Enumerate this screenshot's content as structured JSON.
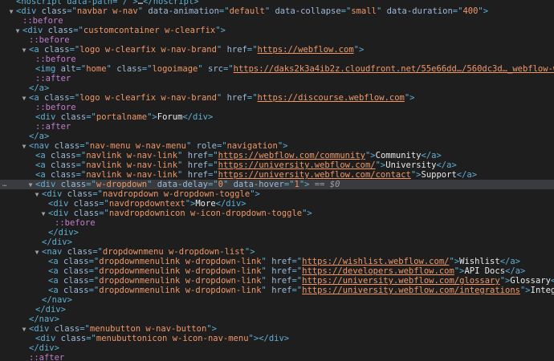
{
  "lines": [
    {
      "indent": 0,
      "arrow": "",
      "parts": [
        {
          "t": "tag",
          "v": "<noscript data-path=\"/\">"
        },
        {
          "t": "text",
          "v": "…"
        },
        {
          "t": "tag",
          "v": "</noscript>"
        }
      ]
    },
    {
      "indent": 0,
      "arrow": "▼",
      "parts": [
        {
          "t": "tag",
          "v": "<div "
        },
        {
          "t": "attr",
          "v": "class"
        },
        {
          "t": "tag",
          "v": "=\""
        },
        {
          "t": "val",
          "v": "navbar w-nav"
        },
        {
          "t": "tag",
          "v": "\" "
        },
        {
          "t": "attr",
          "v": "data-animation"
        },
        {
          "t": "tag",
          "v": "=\""
        },
        {
          "t": "val",
          "v": "default"
        },
        {
          "t": "tag",
          "v": "\" "
        },
        {
          "t": "attr",
          "v": "data-collapse"
        },
        {
          "t": "tag",
          "v": "=\""
        },
        {
          "t": "val",
          "v": "small"
        },
        {
          "t": "tag",
          "v": "\" "
        },
        {
          "t": "attr",
          "v": "data-duration"
        },
        {
          "t": "tag",
          "v": "=\""
        },
        {
          "t": "val",
          "v": "400"
        },
        {
          "t": "tag",
          "v": "\">"
        }
      ]
    },
    {
      "indent": 1,
      "arrow": "",
      "parts": [
        {
          "t": "pseudo",
          "v": "::before"
        }
      ]
    },
    {
      "indent": 1,
      "arrow": "▼",
      "parts": [
        {
          "t": "tag",
          "v": "<div "
        },
        {
          "t": "attr",
          "v": "class"
        },
        {
          "t": "tag",
          "v": "=\""
        },
        {
          "t": "val",
          "v": "customcontainer w-clearfix"
        },
        {
          "t": "tag",
          "v": "\">"
        }
      ]
    },
    {
      "indent": 2,
      "arrow": "",
      "parts": [
        {
          "t": "pseudo",
          "v": "::before"
        }
      ]
    },
    {
      "indent": 2,
      "arrow": "▼",
      "parts": [
        {
          "t": "tag",
          "v": "<a "
        },
        {
          "t": "attr",
          "v": "class"
        },
        {
          "t": "tag",
          "v": "=\""
        },
        {
          "t": "val",
          "v": "logo w-clearfix w-nav-brand"
        },
        {
          "t": "tag",
          "v": "\" "
        },
        {
          "t": "attr",
          "v": "href"
        },
        {
          "t": "tag",
          "v": "=\""
        },
        {
          "t": "link",
          "v": "https://webflow.com"
        },
        {
          "t": "tag",
          "v": "\">"
        }
      ]
    },
    {
      "indent": 3,
      "arrow": "",
      "parts": [
        {
          "t": "pseudo",
          "v": "::before"
        }
      ]
    },
    {
      "indent": 3,
      "arrow": "",
      "parts": [
        {
          "t": "tag",
          "v": "<img "
        },
        {
          "t": "attr",
          "v": "alt"
        },
        {
          "t": "tag",
          "v": "=\""
        },
        {
          "t": "val",
          "v": "home"
        },
        {
          "t": "tag",
          "v": "\" "
        },
        {
          "t": "attr",
          "v": "class"
        },
        {
          "t": "tag",
          "v": "=\""
        },
        {
          "t": "val",
          "v": "logoimage"
        },
        {
          "t": "tag",
          "v": "\" "
        },
        {
          "t": "attr",
          "v": "src"
        },
        {
          "t": "tag",
          "v": "=\""
        },
        {
          "t": "link",
          "v": "https://daks2k3a4ib2z.cloudfront.net/55e66dd…/560dc3d…_webflow-white.svg"
        },
        {
          "t": "tag",
          "v": "\" "
        },
        {
          "t": "attr",
          "v": "width"
        },
        {
          "t": "tag",
          "v": "=\""
        },
        {
          "t": "val",
          "v": "87"
        },
        {
          "t": "tag",
          "v": "\">"
        }
      ]
    },
    {
      "indent": 3,
      "arrow": "",
      "parts": [
        {
          "t": "pseudo",
          "v": "::after"
        }
      ]
    },
    {
      "indent": 2,
      "arrow": "",
      "parts": [
        {
          "t": "tag",
          "v": "</a>"
        }
      ]
    },
    {
      "indent": 2,
      "arrow": "▼",
      "parts": [
        {
          "t": "tag",
          "v": "<a "
        },
        {
          "t": "attr",
          "v": "class"
        },
        {
          "t": "tag",
          "v": "=\""
        },
        {
          "t": "val",
          "v": "logo w-clearfix w-nav-brand"
        },
        {
          "t": "tag",
          "v": "\" "
        },
        {
          "t": "attr",
          "v": "href"
        },
        {
          "t": "tag",
          "v": "=\""
        },
        {
          "t": "link",
          "v": "https://discourse.webflow.com"
        },
        {
          "t": "tag",
          "v": "\">"
        }
      ]
    },
    {
      "indent": 3,
      "arrow": "",
      "parts": [
        {
          "t": "pseudo",
          "v": "::before"
        }
      ]
    },
    {
      "indent": 3,
      "arrow": "",
      "parts": [
        {
          "t": "tag",
          "v": "<div "
        },
        {
          "t": "attr",
          "v": "class"
        },
        {
          "t": "tag",
          "v": "=\""
        },
        {
          "t": "val",
          "v": "portalname"
        },
        {
          "t": "tag",
          "v": "\">"
        },
        {
          "t": "text",
          "v": "Forum"
        },
        {
          "t": "tag",
          "v": "</div>"
        }
      ]
    },
    {
      "indent": 3,
      "arrow": "",
      "parts": [
        {
          "t": "pseudo",
          "v": "::after"
        }
      ]
    },
    {
      "indent": 2,
      "arrow": "",
      "parts": [
        {
          "t": "tag",
          "v": "</a>"
        }
      ]
    },
    {
      "indent": 2,
      "arrow": "▼",
      "parts": [
        {
          "t": "tag",
          "v": "<nav "
        },
        {
          "t": "attr",
          "v": "class"
        },
        {
          "t": "tag",
          "v": "=\""
        },
        {
          "t": "val",
          "v": "nav-menu w-nav-menu"
        },
        {
          "t": "tag",
          "v": "\" "
        },
        {
          "t": "attr",
          "v": "role"
        },
        {
          "t": "tag",
          "v": "=\""
        },
        {
          "t": "val",
          "v": "navigation"
        },
        {
          "t": "tag",
          "v": "\">"
        }
      ]
    },
    {
      "indent": 3,
      "arrow": "",
      "parts": [
        {
          "t": "tag",
          "v": "<a "
        },
        {
          "t": "attr",
          "v": "class"
        },
        {
          "t": "tag",
          "v": "=\""
        },
        {
          "t": "val",
          "v": "navlink w-nav-link"
        },
        {
          "t": "tag",
          "v": "\" "
        },
        {
          "t": "attr",
          "v": "href"
        },
        {
          "t": "tag",
          "v": "=\""
        },
        {
          "t": "link",
          "v": "https://webflow.com/community"
        },
        {
          "t": "tag",
          "v": "\">"
        },
        {
          "t": "text",
          "v": "Community"
        },
        {
          "t": "tag",
          "v": "</a>"
        }
      ]
    },
    {
      "indent": 3,
      "arrow": "",
      "parts": [
        {
          "t": "tag",
          "v": "<a "
        },
        {
          "t": "attr",
          "v": "class"
        },
        {
          "t": "tag",
          "v": "=\""
        },
        {
          "t": "val",
          "v": "navlink w-nav-link"
        },
        {
          "t": "tag",
          "v": "\" "
        },
        {
          "t": "attr",
          "v": "href"
        },
        {
          "t": "tag",
          "v": "=\""
        },
        {
          "t": "link",
          "v": "https://university.webflow.com/"
        },
        {
          "t": "tag",
          "v": "\">"
        },
        {
          "t": "text",
          "v": "University"
        },
        {
          "t": "tag",
          "v": "</a>"
        }
      ]
    },
    {
      "indent": 3,
      "arrow": "",
      "parts": [
        {
          "t": "tag",
          "v": "<a "
        },
        {
          "t": "attr",
          "v": "class"
        },
        {
          "t": "tag",
          "v": "=\""
        },
        {
          "t": "val",
          "v": "navlink w-nav-link"
        },
        {
          "t": "tag",
          "v": "\" "
        },
        {
          "t": "attr",
          "v": "href"
        },
        {
          "t": "tag",
          "v": "=\""
        },
        {
          "t": "link",
          "v": "https://university.webflow.com/contact"
        },
        {
          "t": "tag",
          "v": "\">"
        },
        {
          "t": "text",
          "v": "Support"
        },
        {
          "t": "tag",
          "v": "</a>"
        }
      ]
    },
    {
      "indent": 3,
      "arrow": "▼",
      "selected": true,
      "gutter": "…",
      "parts": [
        {
          "t": "tag",
          "v": "<div "
        },
        {
          "t": "attr",
          "v": "class"
        },
        {
          "t": "tag",
          "v": "=\""
        },
        {
          "t": "val",
          "v": "w-dropdown"
        },
        {
          "t": "tag",
          "v": "\" "
        },
        {
          "t": "attr",
          "v": "data-delay"
        },
        {
          "t": "tag",
          "v": "=\""
        },
        {
          "t": "val",
          "v": "0"
        },
        {
          "t": "tag",
          "v": "\" "
        },
        {
          "t": "attr",
          "v": "data-hover"
        },
        {
          "t": "tag",
          "v": "=\""
        },
        {
          "t": "val",
          "v": "1"
        },
        {
          "t": "tag",
          "v": "\">"
        },
        {
          "t": "eq",
          "v": " == "
        },
        {
          "t": "dollar",
          "v": "$0"
        }
      ]
    },
    {
      "indent": 4,
      "arrow": "▼",
      "parts": [
        {
          "t": "tag",
          "v": "<div "
        },
        {
          "t": "attr",
          "v": "class"
        },
        {
          "t": "tag",
          "v": "=\""
        },
        {
          "t": "val",
          "v": "navdropdown w-dropdown-toggle"
        },
        {
          "t": "tag",
          "v": "\">"
        }
      ]
    },
    {
      "indent": 5,
      "arrow": "",
      "parts": [
        {
          "t": "tag",
          "v": "<div "
        },
        {
          "t": "attr",
          "v": "class"
        },
        {
          "t": "tag",
          "v": "=\""
        },
        {
          "t": "val",
          "v": "navdropdowntext"
        },
        {
          "t": "tag",
          "v": "\">"
        },
        {
          "t": "text",
          "v": "More"
        },
        {
          "t": "tag",
          "v": "</div>"
        }
      ]
    },
    {
      "indent": 5,
      "arrow": "▼",
      "parts": [
        {
          "t": "tag",
          "v": "<div "
        },
        {
          "t": "attr",
          "v": "class"
        },
        {
          "t": "tag",
          "v": "=\""
        },
        {
          "t": "val",
          "v": "navdropdownicon w-icon-dropdown-toggle"
        },
        {
          "t": "tag",
          "v": "\">"
        }
      ]
    },
    {
      "indent": 6,
      "arrow": "",
      "parts": [
        {
          "t": "pseudo",
          "v": "::before"
        }
      ]
    },
    {
      "indent": 5,
      "arrow": "",
      "parts": [
        {
          "t": "tag",
          "v": "</div>"
        }
      ]
    },
    {
      "indent": 4,
      "arrow": "",
      "parts": [
        {
          "t": "tag",
          "v": "</div>"
        }
      ]
    },
    {
      "indent": 4,
      "arrow": "▼",
      "parts": [
        {
          "t": "tag",
          "v": "<nav "
        },
        {
          "t": "attr",
          "v": "class"
        },
        {
          "t": "tag",
          "v": "=\""
        },
        {
          "t": "val",
          "v": "dropdownmenu w-dropdown-list"
        },
        {
          "t": "tag",
          "v": "\">"
        }
      ]
    },
    {
      "indent": 5,
      "arrow": "",
      "parts": [
        {
          "t": "tag",
          "v": "<a "
        },
        {
          "t": "attr",
          "v": "class"
        },
        {
          "t": "tag",
          "v": "=\""
        },
        {
          "t": "val",
          "v": "dropdownmenulink w-dropdown-link"
        },
        {
          "t": "tag",
          "v": "\" "
        },
        {
          "t": "attr",
          "v": "href"
        },
        {
          "t": "tag",
          "v": "=\""
        },
        {
          "t": "link",
          "v": "https://wishlist.webflow.com/"
        },
        {
          "t": "tag",
          "v": "\">"
        },
        {
          "t": "text",
          "v": "Wishlist"
        },
        {
          "t": "tag",
          "v": "</a>"
        }
      ]
    },
    {
      "indent": 5,
      "arrow": "",
      "parts": [
        {
          "t": "tag",
          "v": "<a "
        },
        {
          "t": "attr",
          "v": "class"
        },
        {
          "t": "tag",
          "v": "=\""
        },
        {
          "t": "val",
          "v": "dropdownmenulink w-dropdown-link"
        },
        {
          "t": "tag",
          "v": "\" "
        },
        {
          "t": "attr",
          "v": "href"
        },
        {
          "t": "tag",
          "v": "=\""
        },
        {
          "t": "link",
          "v": "https://developers.webflow.com"
        },
        {
          "t": "tag",
          "v": "\">"
        },
        {
          "t": "text",
          "v": "API Docs"
        },
        {
          "t": "tag",
          "v": "</a>"
        }
      ]
    },
    {
      "indent": 5,
      "arrow": "",
      "parts": [
        {
          "t": "tag",
          "v": "<a "
        },
        {
          "t": "attr",
          "v": "class"
        },
        {
          "t": "tag",
          "v": "=\""
        },
        {
          "t": "val",
          "v": "dropdownmenulink w-dropdown-link"
        },
        {
          "t": "tag",
          "v": "\" "
        },
        {
          "t": "attr",
          "v": "href"
        },
        {
          "t": "tag",
          "v": "=\""
        },
        {
          "t": "link",
          "v": "https://university.webflow.com/glossary"
        },
        {
          "t": "tag",
          "v": "\">"
        },
        {
          "t": "text",
          "v": "Glossary"
        },
        {
          "t": "tag",
          "v": "</a>"
        }
      ]
    },
    {
      "indent": 5,
      "arrow": "",
      "parts": [
        {
          "t": "tag",
          "v": "<a "
        },
        {
          "t": "attr",
          "v": "class"
        },
        {
          "t": "tag",
          "v": "=\""
        },
        {
          "t": "val",
          "v": "dropdownmenulink w-dropdown-link"
        },
        {
          "t": "tag",
          "v": "\" "
        },
        {
          "t": "attr",
          "v": "href"
        },
        {
          "t": "tag",
          "v": "=\""
        },
        {
          "t": "link",
          "v": "https://university.webflow.com/integrations"
        },
        {
          "t": "tag",
          "v": "\">"
        },
        {
          "t": "text",
          "v": "Integrations"
        },
        {
          "t": "tag",
          "v": "</a>"
        }
      ]
    },
    {
      "indent": 4,
      "arrow": "",
      "parts": [
        {
          "t": "tag",
          "v": "</nav>"
        }
      ]
    },
    {
      "indent": 3,
      "arrow": "",
      "parts": [
        {
          "t": "tag",
          "v": "</div>"
        }
      ]
    },
    {
      "indent": 2,
      "arrow": "",
      "parts": [
        {
          "t": "tag",
          "v": "</nav>"
        }
      ]
    },
    {
      "indent": 2,
      "arrow": "▼",
      "parts": [
        {
          "t": "tag",
          "v": "<div "
        },
        {
          "t": "attr",
          "v": "class"
        },
        {
          "t": "tag",
          "v": "=\""
        },
        {
          "t": "val",
          "v": "menubutton w-nav-button"
        },
        {
          "t": "tag",
          "v": "\">"
        }
      ]
    },
    {
      "indent": 3,
      "arrow": "",
      "parts": [
        {
          "t": "tag",
          "v": "<div "
        },
        {
          "t": "attr",
          "v": "class"
        },
        {
          "t": "tag",
          "v": "=\""
        },
        {
          "t": "val",
          "v": "menubuttonicon w-icon-nav-menu"
        },
        {
          "t": "tag",
          "v": "\">"
        },
        {
          "t": "tag",
          "v": "</div>"
        }
      ]
    },
    {
      "indent": 2,
      "arrow": "",
      "parts": [
        {
          "t": "tag",
          "v": "</div>"
        }
      ]
    },
    {
      "indent": 2,
      "arrow": "",
      "parts": [
        {
          "t": "pseudo",
          "v": "::after"
        }
      ]
    }
  ]
}
